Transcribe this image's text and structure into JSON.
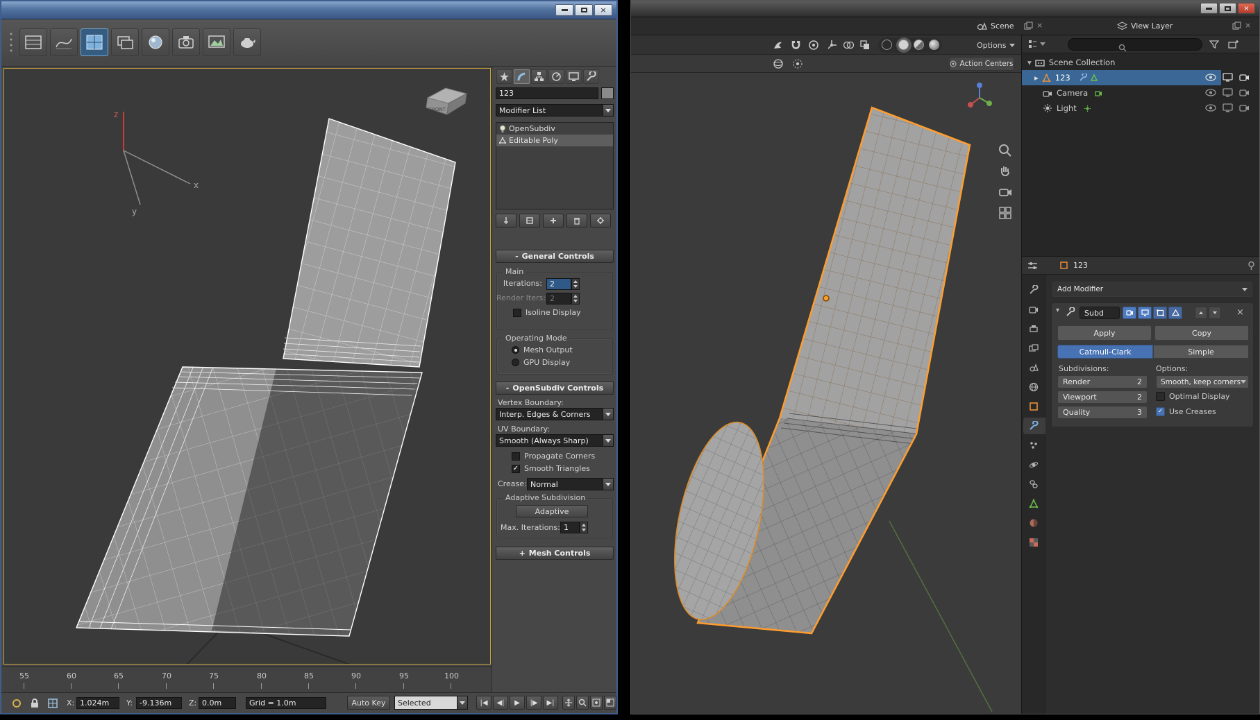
{
  "icons": {
    "close_glyph": "×",
    "check": "✓",
    "tri_down": "▾",
    "tri_right": "▸"
  },
  "colors": {
    "max_titlebar_blue": "#4a6b98",
    "max_viewport_border_yellow": "#c9a33b",
    "blender_select_orange": "#ff9d2e",
    "blender_accent_blue": "#4772b3",
    "outliner_selection_blue": "#3a6795"
  },
  "max": {
    "viewport": {
      "axis_x": "x",
      "axis_y": "y",
      "axis_z": "z",
      "viewcube_label": "FRONT"
    },
    "panel": {
      "object_name": "123",
      "modifier_list": "Modifier List",
      "stack": [
        {
          "label": "OpenSubdiv"
        },
        {
          "label": "Editable Poly"
        }
      ],
      "general": {
        "collapse": "-",
        "title": "General Controls",
        "main_group": "Main",
        "iterations_label": "Iterations:",
        "iterations_value": "2",
        "render_iters_label": "Render Iters:",
        "render_iters_value": "2",
        "isoline_label": "Isoline Display",
        "operating_mode_group": "Operating Mode",
        "mesh_output": "Mesh Output",
        "gpu_display": "GPU Display"
      },
      "osd": {
        "collapse": "-",
        "title": "OpenSubdiv Controls",
        "vertex_boundary_label": "Vertex Boundary:",
        "vertex_boundary_value": "Interp. Edges & Corners",
        "uv_boundary_label": "UV Boundary:",
        "uv_boundary_value": "Smooth (Always Sharp)",
        "propagate_corners": "Propagate Corners",
        "smooth_triangles": "Smooth Triangles",
        "crease_label": "Crease:",
        "crease_value": "Normal",
        "adaptive_group": "Adaptive Subdivision",
        "adaptive_button": "Adaptive",
        "max_iterations_label": "Max. Iterations:",
        "max_iterations_value": "1"
      },
      "mesh_controls": {
        "collapse": "+",
        "title": "Mesh Controls"
      }
    },
    "timeline": {
      "ticks": [
        "55",
        "60",
        "65",
        "70",
        "75",
        "80",
        "85",
        "90",
        "95",
        "100"
      ]
    },
    "status": {
      "x_label": "X:",
      "x_value": "1.024m",
      "y_label": "Y:",
      "y_value": "-9.136m",
      "z_label": "Z:",
      "z_value": "0.0m",
      "grid_label": "Grid = 1.0m",
      "auto_key": "Auto Key",
      "selected": "Selected",
      "playback": [
        "|◀",
        "◀|",
        "▶",
        "|▶",
        "▶|"
      ]
    }
  },
  "blender": {
    "topbar": {
      "scene": "Scene",
      "view_layer": "View Layer"
    },
    "header": {
      "options": "Options",
      "action_centers": "Action Centers"
    },
    "outliner": {
      "scene_collection": "Scene Collection",
      "object": "123",
      "camera": "Camera",
      "light": "Light"
    },
    "props": {
      "breadcrumb": "123",
      "add_modifier": "Add Modifier",
      "mod": {
        "name": "Subd",
        "apply": "Apply",
        "copy": "Copy",
        "catmull": "Catmull-Clark",
        "simple": "Simple",
        "subdivisions_label": "Subdivisions:",
        "render_label": "Render",
        "render_value": "2",
        "viewport_label": "Viewport",
        "viewport_value": "2",
        "quality_label": "Quality",
        "quality_value": "3",
        "options_label": "Options:",
        "uv_smooth_value": "Smooth, keep corners",
        "optimal_display": "Optimal Display",
        "use_creases": "Use Creases"
      }
    }
  }
}
